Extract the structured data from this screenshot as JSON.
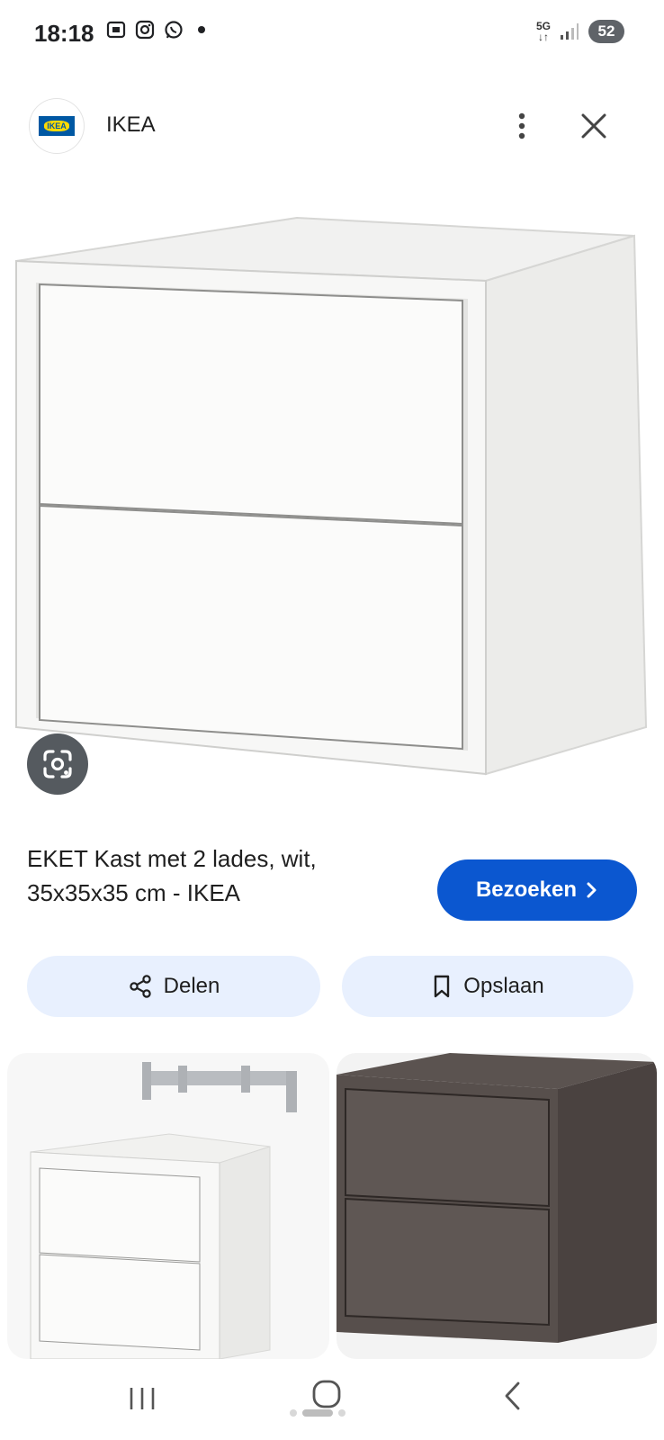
{
  "status_bar": {
    "time": "18:18",
    "network": "5G",
    "battery": "52"
  },
  "header": {
    "site_name": "IKEA",
    "logo_text": "IKEA"
  },
  "result": {
    "title": "EKET Kast met 2 lades, wit, 35x35x35 cm - IKEA",
    "visit_label": "Bezoeken",
    "visit_color": "#0b57d0"
  },
  "actions": {
    "share_label": "Delen",
    "save_label": "Opslaan",
    "pill_color": "#e8f0fe"
  },
  "icons": {
    "more": "more-vert-icon",
    "close": "close-icon",
    "lens": "google-lens-icon",
    "share": "share-icon",
    "bookmark": "bookmark-icon",
    "chevron": "chevron-right-icon"
  },
  "related": [
    {
      "name": "EKET white cabinet with wall rail"
    },
    {
      "name": "EKET dark grey cabinet"
    }
  ]
}
